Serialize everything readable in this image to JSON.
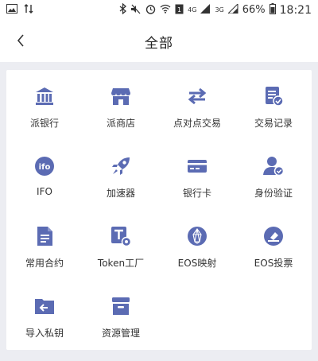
{
  "status_bar": {
    "network_4g": "4G",
    "network_3g": "3G",
    "battery": "66%",
    "time": "18:21"
  },
  "header": {
    "title": "全部"
  },
  "accent_color": "#5b6bb3",
  "items": [
    {
      "label": "派银行",
      "icon": "bank-icon"
    },
    {
      "label": "派商店",
      "icon": "store-icon"
    },
    {
      "label": "点对点交易",
      "icon": "swap-arrows-icon"
    },
    {
      "label": "交易记录",
      "icon": "record-icon"
    },
    {
      "label": "IFO",
      "icon": "ifo-icon"
    },
    {
      "label": "加速器",
      "icon": "rocket-icon"
    },
    {
      "label": "银行卡",
      "icon": "card-icon"
    },
    {
      "label": "身份验证",
      "icon": "user-verify-icon"
    },
    {
      "label": "常用合约",
      "icon": "document-icon"
    },
    {
      "label": "Token工厂",
      "icon": "token-factory-icon"
    },
    {
      "label": "EOS映射",
      "icon": "eos-icon"
    },
    {
      "label": "EOS投票",
      "icon": "vote-icon"
    },
    {
      "label": "导入私钥",
      "icon": "import-key-icon"
    },
    {
      "label": "资源管理",
      "icon": "archive-icon"
    }
  ]
}
